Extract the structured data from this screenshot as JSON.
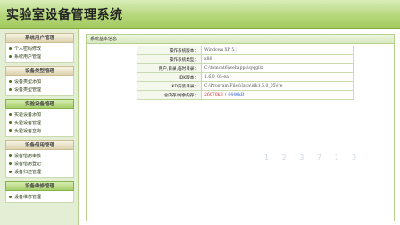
{
  "header": {
    "title": "实验室设备管理系统"
  },
  "sidebar": {
    "groups": [
      {
        "title": "系统用户管理",
        "style": "beige",
        "items": [
          "个人密码修改",
          "系统用户管理"
        ]
      },
      {
        "title": "设备类型管理",
        "style": "beige",
        "items": [
          "设备类型添加",
          "设备类型管理"
        ]
      },
      {
        "title": "实验设备管理",
        "style": "green",
        "items": [
          "实验设备添加",
          "实验设备管理",
          "实验设备查询"
        ]
      },
      {
        "title": "设备借用管理",
        "style": "beige",
        "items": [
          "设备借用审核",
          "设备借用登记",
          "设备归还管理"
        ]
      },
      {
        "title": "设备维修管理",
        "style": "green",
        "items": [
          "设备维修管理"
        ]
      }
    ]
  },
  "content": {
    "panel_title": "系统基本信息",
    "rows": [
      {
        "key": "操作系统版本：",
        "value": "Windows XP 5.1"
      },
      {
        "key": "操作系统类型：",
        "value": "x86"
      },
      {
        "key": "用户,目录,临时目录：",
        "value": "C:\\tomcat6\\webapps\\syqglxt"
      },
      {
        "key": "JDK版本：",
        "value": "1.6.0_05-ea"
      },
      {
        "key": "JKD安装目录：",
        "value": "C:\\Program Files\\Java\\jdk1.6.0_05\\jre"
      }
    ],
    "memory": {
      "key": "总内存/剩余内存：",
      "used": "26070kB",
      "separator": "/",
      "total": "6440kB"
    }
  },
  "watermark": "1 2 3 7 1 3"
}
